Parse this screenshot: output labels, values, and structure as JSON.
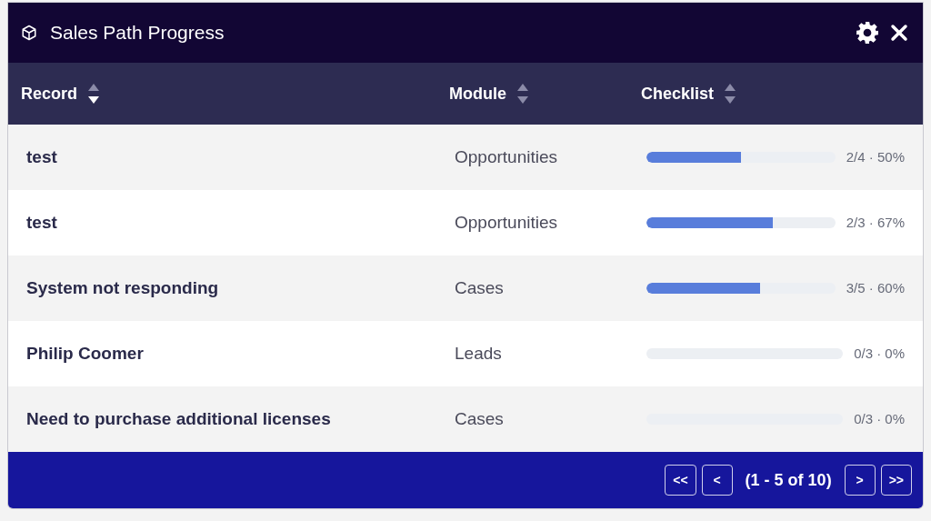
{
  "window": {
    "title": "Sales Path Progress"
  },
  "table": {
    "columns": [
      {
        "label": "Record",
        "sorted": true
      },
      {
        "label": "Module",
        "sorted": false
      },
      {
        "label": "Checklist",
        "sorted": false
      }
    ],
    "rows": [
      {
        "record": "test",
        "module": "Opportunities",
        "level": 0.5,
        "reading": "2/4 · 50%"
      },
      {
        "record": "test",
        "module": "Opportunities",
        "level": 0.67,
        "reading": "2/3 · 67%"
      },
      {
        "record": "System not responding",
        "module": "Cases",
        "level": 0.6,
        "reading": "3/5 · 60%"
      },
      {
        "record": "Philip Coomer",
        "module": "Leads",
        "level": 0,
        "reading": "0/3 · 0%"
      },
      {
        "record": "Need to purchase additional licenses",
        "module": "Cases",
        "level": 0,
        "reading": "0/3 · 0%"
      }
    ]
  },
  "pagination": {
    "first": "<<",
    "prev": "<",
    "status": "(1 - 5 of 10)",
    "next": ">",
    "last": ">>"
  }
}
